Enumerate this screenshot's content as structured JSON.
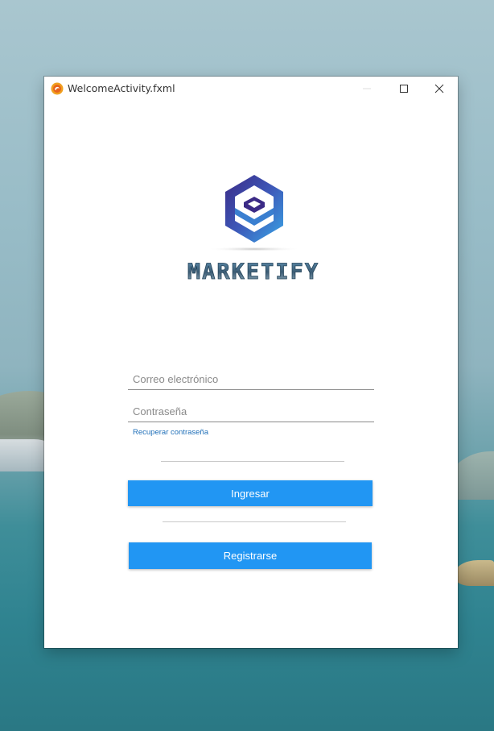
{
  "window": {
    "title": "WelcomeActivity.fxml"
  },
  "brand": {
    "name": "MARKETIFY",
    "colors": {
      "hexagon_dark": "#3b2a86",
      "hexagon_light": "#3aa6e6",
      "wordmark": "#3c5c74"
    }
  },
  "login_form": {
    "email_placeholder": "Correo electrónico",
    "email_value": "",
    "password_placeholder": "Contraseña",
    "password_value": "",
    "recover_link": "Recuperar contraseña",
    "login_button": "Ingresar",
    "register_button": "Registrarse"
  },
  "theme": {
    "accent": "#2196f3"
  }
}
